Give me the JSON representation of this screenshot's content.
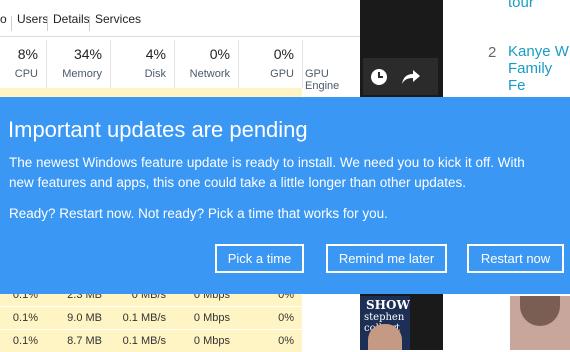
{
  "task_manager": {
    "tabs": [
      "o",
      "Users",
      "Details",
      "Services"
    ],
    "columns": [
      {
        "pct": "8%",
        "label": "CPU"
      },
      {
        "pct": "34%",
        "label": "Memory"
      },
      {
        "pct": "4%",
        "label": "Disk"
      },
      {
        "pct": "0%",
        "label": "Network"
      },
      {
        "pct": "0%",
        "label": "GPU"
      },
      {
        "pct": "",
        "label": "GPU Engine"
      }
    ],
    "rows": [
      [
        "0.1%",
        "2.3 MB",
        "0 MB/s",
        "0 Mbps",
        "0%"
      ],
      [
        "0.1%",
        "9.0 MB",
        "0.1 MB/s",
        "0 Mbps",
        "0%"
      ],
      [
        "0.1%",
        "8.7 MB",
        "0.1 MB/s",
        "0 Mbps",
        "0%"
      ]
    ]
  },
  "media": {
    "video_title_1": "SHOW",
    "video_title_2": "stephen colbert"
  },
  "web": {
    "top_text": "tour",
    "item_number": "2",
    "item_link_line1": "Kanye W",
    "item_link_line2": "Family Fe"
  },
  "banner": {
    "title": "Important updates are pending",
    "body": "The newest Windows feature update is ready to install. We need you to kick it off. With new features and apps, this one could take a little longer than other updates.",
    "body2": "Ready? Restart now. Not ready? Pick a time that works for you.",
    "buttons": {
      "pick_time": "Pick a time",
      "remind_later": "Remind me later",
      "restart_now": "Restart now"
    },
    "colors": {
      "background": "#3a97f4",
      "text": "#ffffff"
    }
  }
}
